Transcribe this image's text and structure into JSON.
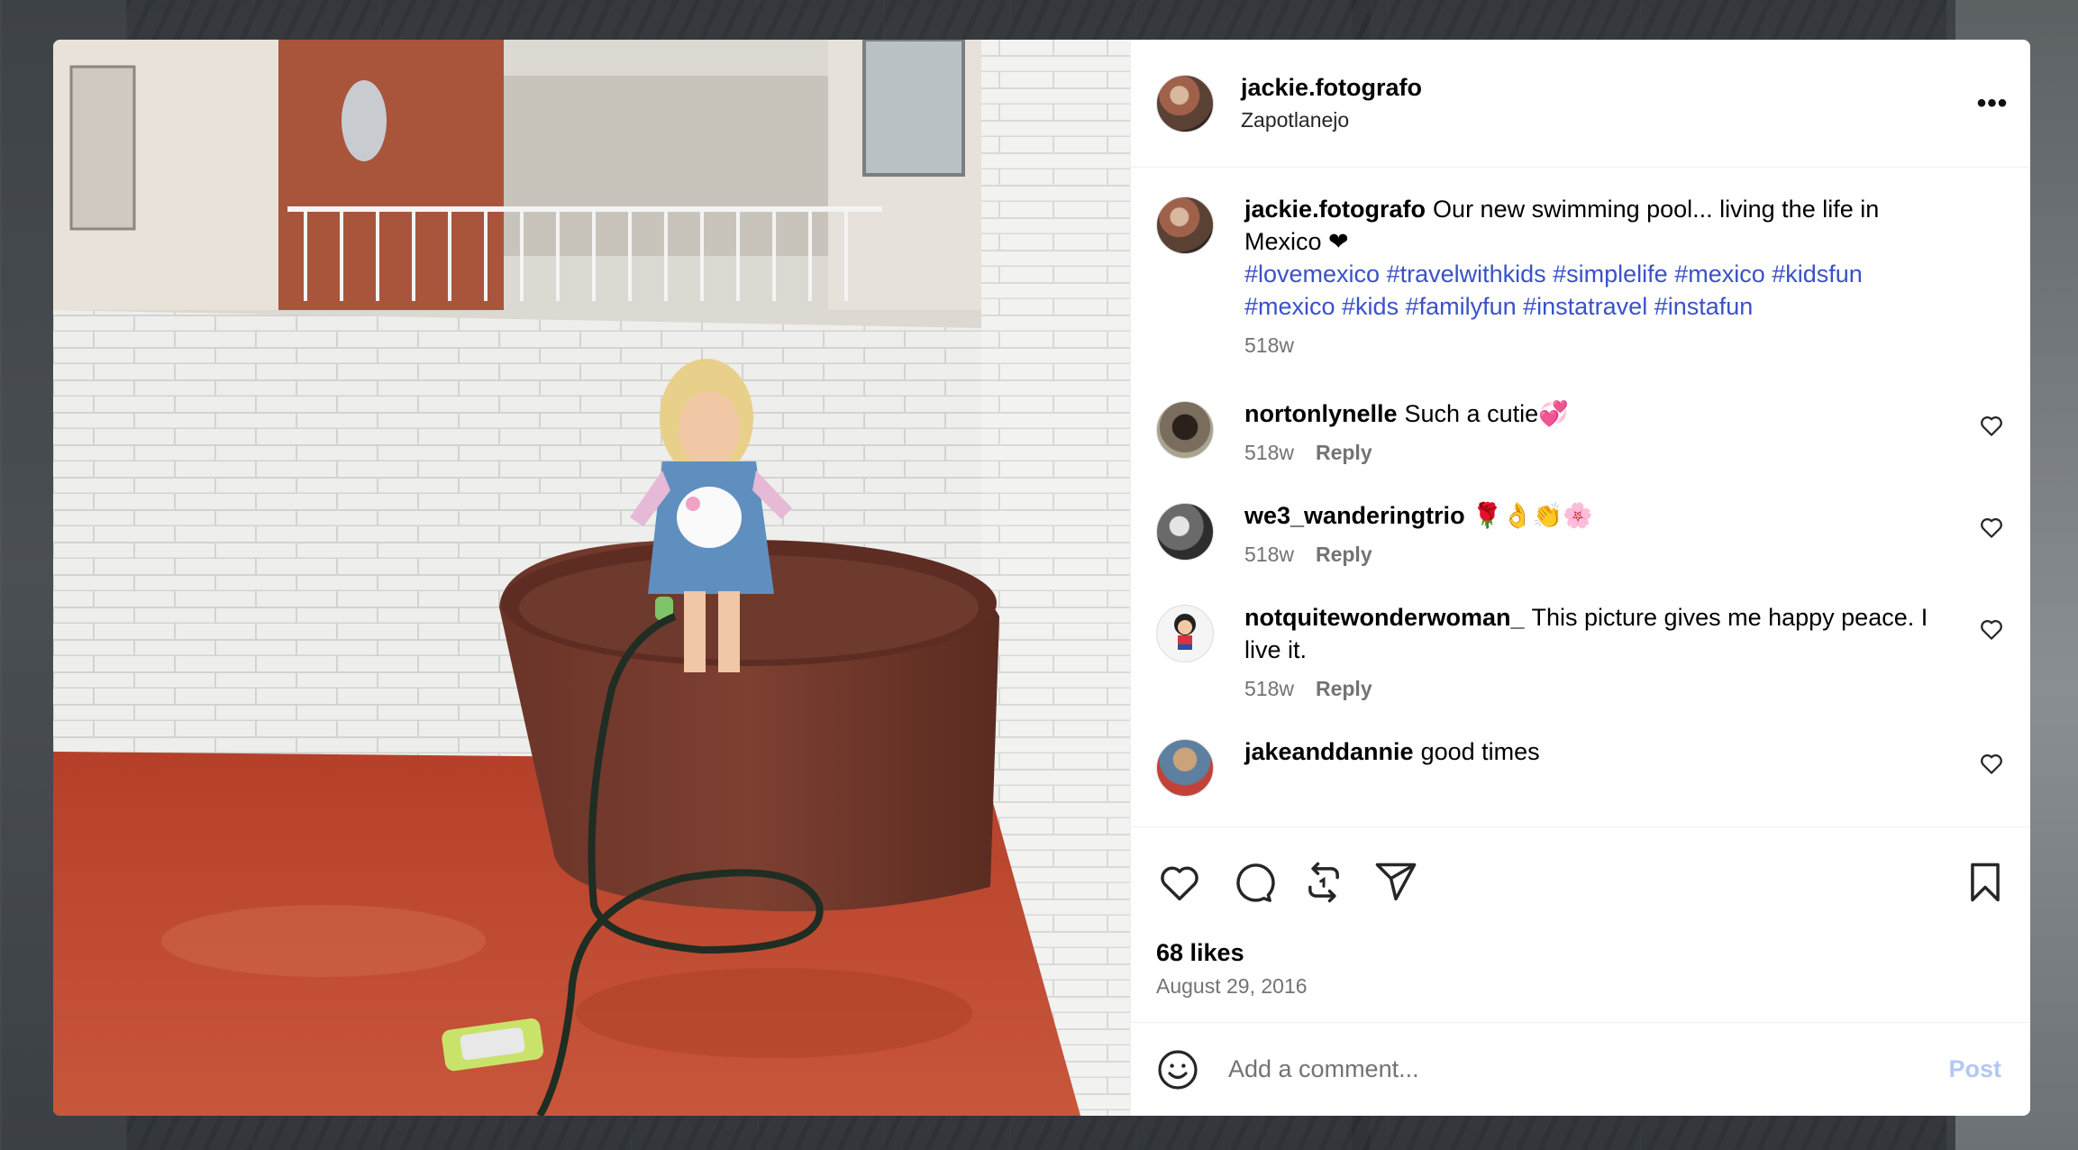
{
  "post": {
    "username": "jackie.fotografo",
    "location": "Zapotlanejo",
    "more_label": "•••",
    "caption": {
      "username": "jackie.fotografo",
      "text": "Our new swimming pool... living the life in Mexico ❤",
      "hashtags": "#lovemexico #travelwithkids #simplelife #mexico #kidsfun #mexico #kids #familyfun #instatravel #instafun",
      "time": "518w"
    },
    "comments": [
      {
        "username": "nortonlynelle",
        "text": "Such a cutie💞",
        "time": "518w",
        "reply": "Reply"
      },
      {
        "username": "we3_wanderingtrio",
        "text": "🌹👌👏🌸",
        "time": "518w",
        "reply": "Reply"
      },
      {
        "username": "notquitewonderwoman_",
        "text": "This picture gives me happy peace. I live it.",
        "time": "518w",
        "reply": "Reply"
      },
      {
        "username": "jakeanddannie",
        "text": "good times",
        "time": "",
        "reply": ""
      }
    ],
    "likes": "68 likes",
    "date": "August 29, 2016",
    "add_comment": {
      "placeholder": "Add a comment...",
      "post_label": "Post"
    }
  },
  "icons": {
    "like": "heart-icon",
    "comment": "comment-bubble-icon",
    "repost": "repost-icon",
    "share": "paper-plane-icon",
    "save": "bookmark-icon",
    "emoji": "smiley-icon"
  },
  "colors": {
    "hashtag": "#3a52c6",
    "secondary_text": "#737373",
    "post_button": "#b3c8f5"
  }
}
